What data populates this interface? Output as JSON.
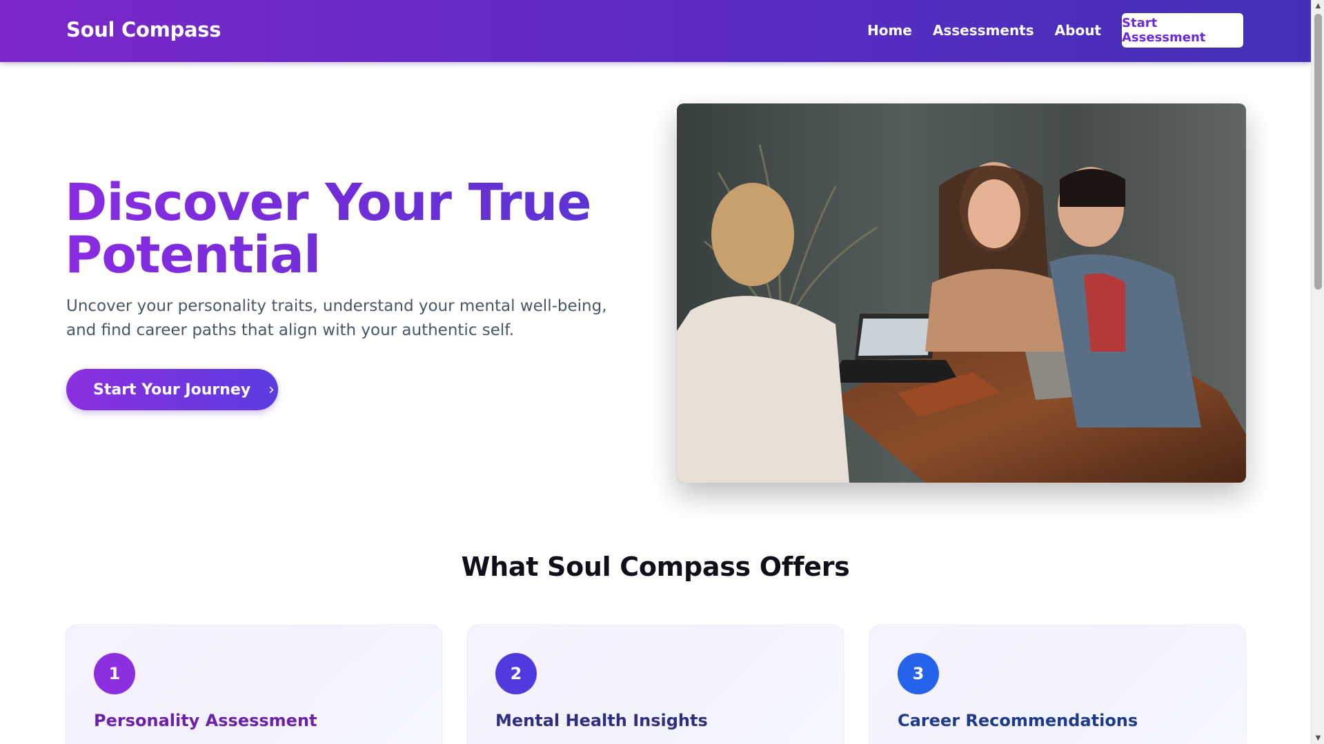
{
  "header": {
    "brand": "Soul Compass",
    "nav": [
      {
        "label": "Home"
      },
      {
        "label": "Assessments"
      },
      {
        "label": "About"
      }
    ],
    "cta_label": "Start Assessment"
  },
  "hero": {
    "title": "Discover Your True Potential",
    "subtitle": "Uncover your personality traits, understand your mental well-being, and find career paths that align with your authentic self.",
    "button_label": "Start Your Journey",
    "button_icon": "chevron-right-icon"
  },
  "offers": {
    "title": "What Soul Compass Offers",
    "cards": [
      {
        "number": "1",
        "title": "Personality Assessment",
        "badge_color": "#8b2fe0",
        "title_color": "#6b21a8"
      },
      {
        "number": "2",
        "title": "Mental Health Insights",
        "badge_color": "#4f3ae0",
        "title_color": "#312e81"
      },
      {
        "number": "3",
        "title": "Career Recommendations",
        "badge_color": "#2563eb",
        "title_color": "#1e3a8a"
      }
    ]
  },
  "colors": {
    "brand_purple": "#7b27c9",
    "brand_indigo": "#4430b6"
  }
}
